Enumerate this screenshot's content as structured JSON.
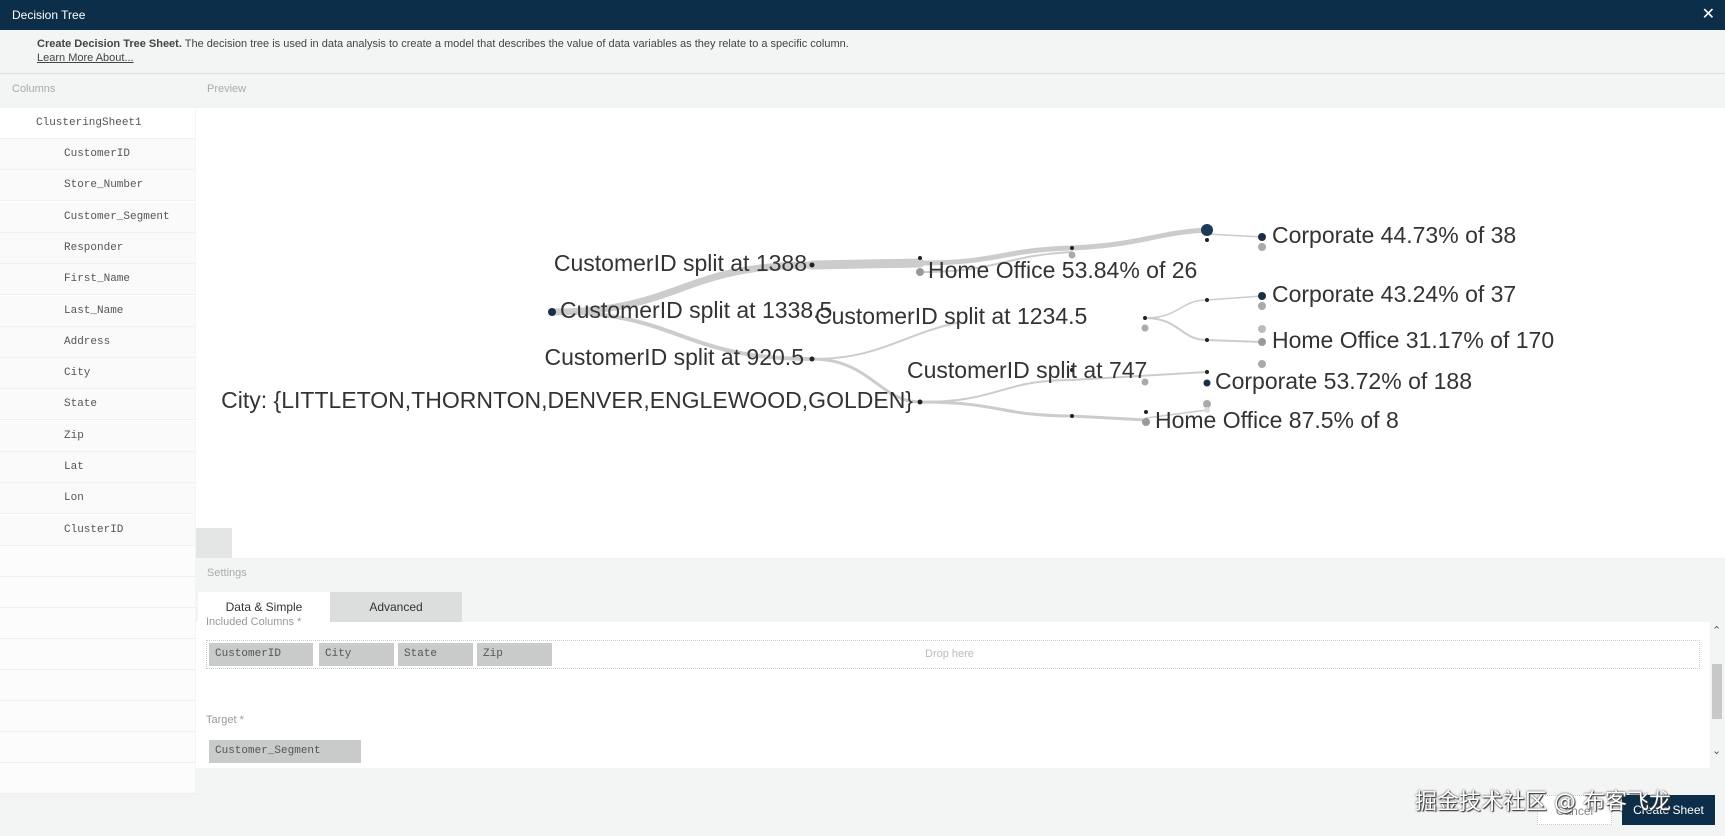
{
  "window": {
    "title": "Decision Tree",
    "close_icon": "close-icon"
  },
  "description": {
    "lead": "Create Decision Tree Sheet.",
    "text": " The decision tree is used in data analysis to create a model that describes the value of data variables as they relate to a specific column.",
    "link": "Learn More About..."
  },
  "columns": {
    "label": "Columns",
    "sheet": "ClusteringSheet1",
    "items": [
      "CustomerID",
      "Store_Number",
      "Customer_Segment",
      "Responder",
      "First_Name",
      "Last_Name",
      "Address",
      "City",
      "State",
      "Zip",
      "Lat",
      "Lon",
      "ClusterID"
    ]
  },
  "preview": {
    "label": "Preview",
    "nodes": [
      "CustomerID split at 1338.5",
      "CustomerID split at 1388",
      "CustomerID split at 920.5",
      "City: {LITTLETON,THORNTON,DENVER,ENGLEWOOD,GOLDEN}",
      "Home Office 53.84% of 26",
      "CustomerID split at 1234.5",
      "CustomerID split at 747",
      "Corporate 44.73% of 38",
      "Corporate 43.24% of 37",
      "Home Office 31.17% of 170",
      "Corporate 53.72% of 188",
      "Home Office 87.5% of 8"
    ]
  },
  "settings": {
    "label": "Settings",
    "tabs": [
      "Data & Simple",
      "Advanced"
    ],
    "included_label": "Included Columns *",
    "included": [
      "CustomerID",
      "City",
      "State",
      "Zip"
    ],
    "drop_placeholder": "Drop here",
    "target_label": "Target *",
    "target": "Customer_Segment"
  },
  "footer": {
    "cancel": "Cancel",
    "create": "Create Sheet",
    "watermark": "掘金技术社区 @ 布客飞龙"
  },
  "colors": {
    "titlebar": "#0c2e48",
    "primary": "#0c2e48"
  }
}
